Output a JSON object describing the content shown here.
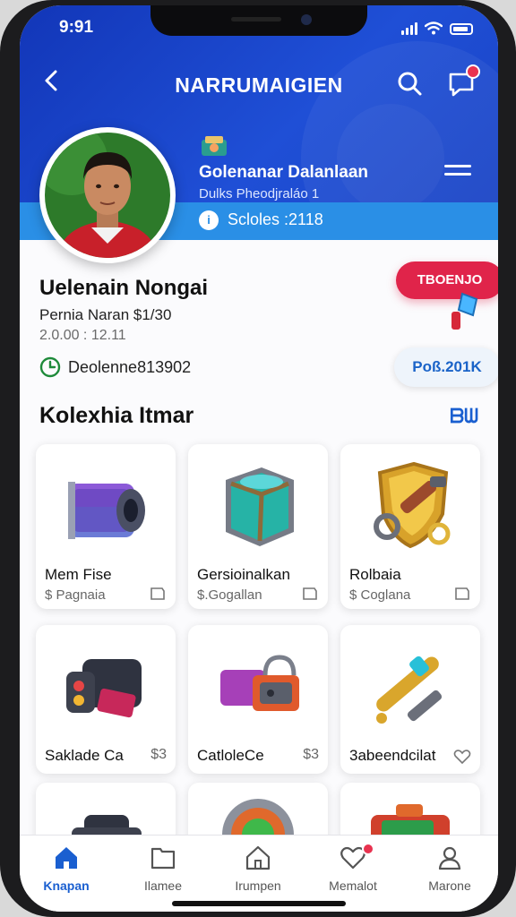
{
  "status_bar": {
    "time": "9:91"
  },
  "header": {
    "title": "NARRUMAIGIEN"
  },
  "club": {
    "name": "Golenanar Dalanlaan",
    "subtitle": "Dulks Pheodjraláo  1",
    "scores": "Scloles :2118"
  },
  "profile": {
    "name": "Uelenain Nongai",
    "line1": "Pernia Naran $1/30",
    "line2": "2.0.00 : 12.11",
    "id": "Deolenne813902"
  },
  "side": {
    "pill_red": "TBOENJO",
    "pill_light": "Poß.201K"
  },
  "collection": {
    "title": "Kolexhia Itmar",
    "action": "ᗷᗯ",
    "cards": [
      {
        "name": "Mem Fise",
        "sub": "$ Pagnaia"
      },
      {
        "name": "Gersioinalkan",
        "sub": "$.Gogallan"
      },
      {
        "name": "Rolbaia",
        "sub": "$ Coglana"
      },
      {
        "name": "Saklade Ca",
        "sub": "$3"
      },
      {
        "name": "CatloleCe",
        "sub": "$3"
      },
      {
        "name": "3abeendcilat",
        "sub": ""
      }
    ]
  },
  "tabs": [
    {
      "label": "Knapan"
    },
    {
      "label": "Ilamee"
    },
    {
      "label": "Irumpen"
    },
    {
      "label": "Memalot"
    },
    {
      "label": "Marone"
    }
  ],
  "colors": {
    "primary": "#1f4fd6",
    "accent_red": "#e0244a",
    "strip": "#2a8fe6",
    "link": "#1a5fd0"
  }
}
